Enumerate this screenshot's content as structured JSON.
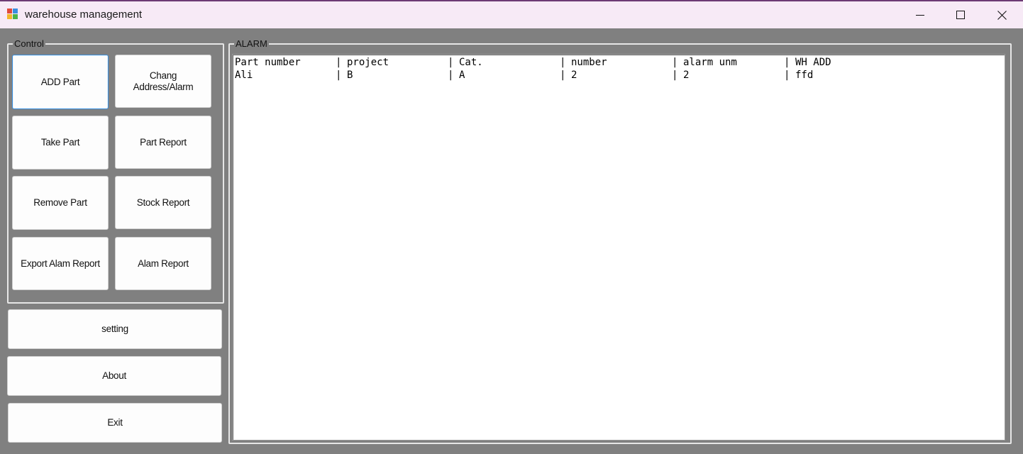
{
  "window": {
    "title": "warehouse management",
    "icon": "app-window-icon",
    "controls": [
      "minimize-icon",
      "maximize-icon",
      "close-icon"
    ]
  },
  "control_group": {
    "legend": "Control",
    "buttons": {
      "add_part": "ADD Part",
      "change_address_line1": "Chang",
      "change_address_line2": "Address/Alarm",
      "take_part": "Take Part",
      "part_report": "Part Report",
      "remove_part": "Remove Part",
      "stock_report": "Stock Report",
      "export_alarm_report": "Export Alam Report",
      "alarm_report": "Alam Report"
    }
  },
  "side_buttons": {
    "setting": "setting",
    "about": "About",
    "exit": "Exit"
  },
  "alarm_group": {
    "legend": "ALARM",
    "columns": [
      "Part number",
      "project",
      "Cat.",
      "number",
      "alarm unm",
      "WH ADD"
    ],
    "rows": [
      [
        "Ali",
        "B",
        "A",
        "2",
        "2",
        "ffd"
      ]
    ]
  },
  "colors": {
    "titlebar_bg": "#f7eaf6",
    "client_bg": "#808080",
    "focus_border": "#3b8fdc"
  }
}
